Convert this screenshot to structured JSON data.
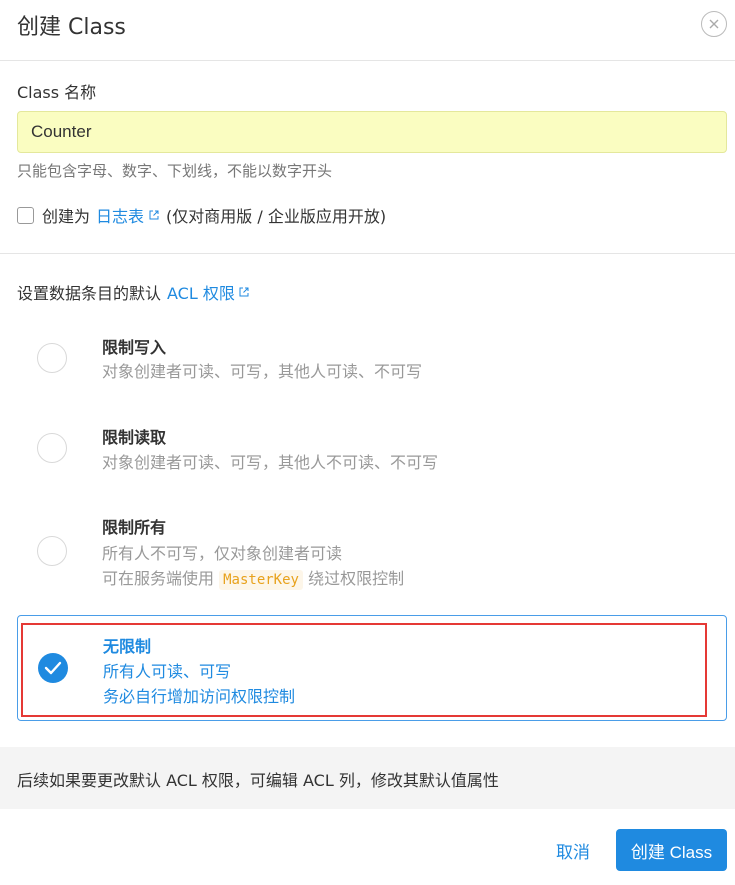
{
  "dialog": {
    "title": "创建 Class",
    "close_icon": "close-icon"
  },
  "name_field": {
    "label": "Class 名称",
    "value": "Counter",
    "hint": "只能包含字母、数字、下划线，不能以数字开头"
  },
  "log_table": {
    "checked": false,
    "prefix": "创建为",
    "link_text": "日志表",
    "suffix": "(仅对商用版 / 企业版应用开放)"
  },
  "acl": {
    "label_prefix": "设置数据条目的默认",
    "link_text": "ACL 权限",
    "options": [
      {
        "title": "限制写入",
        "lines": [
          "对象创建者可读、可写，其他人可读、不可写"
        ],
        "selected": false
      },
      {
        "title": "限制读取",
        "lines": [
          "对象创建者可读、可写，其他人不可读、不可写"
        ],
        "selected": false
      },
      {
        "title": "限制所有",
        "lines": [
          "所有人不可写，仅对象创建者可读"
        ],
        "line2_prefix": "可在服务端使用",
        "line2_code": "MasterKey",
        "line2_suffix": "绕过权限控制",
        "selected": false
      },
      {
        "title": "无限制",
        "lines": [
          "所有人可读、可写",
          "务必自行增加访问权限控制"
        ],
        "selected": true
      }
    ]
  },
  "footer": {
    "note": "后续如果要更改默认 ACL 权限，可编辑 ACL 列，修改其默认值属性",
    "cancel_label": "取消",
    "create_label": "创建 Class"
  },
  "colors": {
    "accent": "#1f8ae0",
    "input_bg": "#fafdc1",
    "highlight_border": "#e53935"
  }
}
